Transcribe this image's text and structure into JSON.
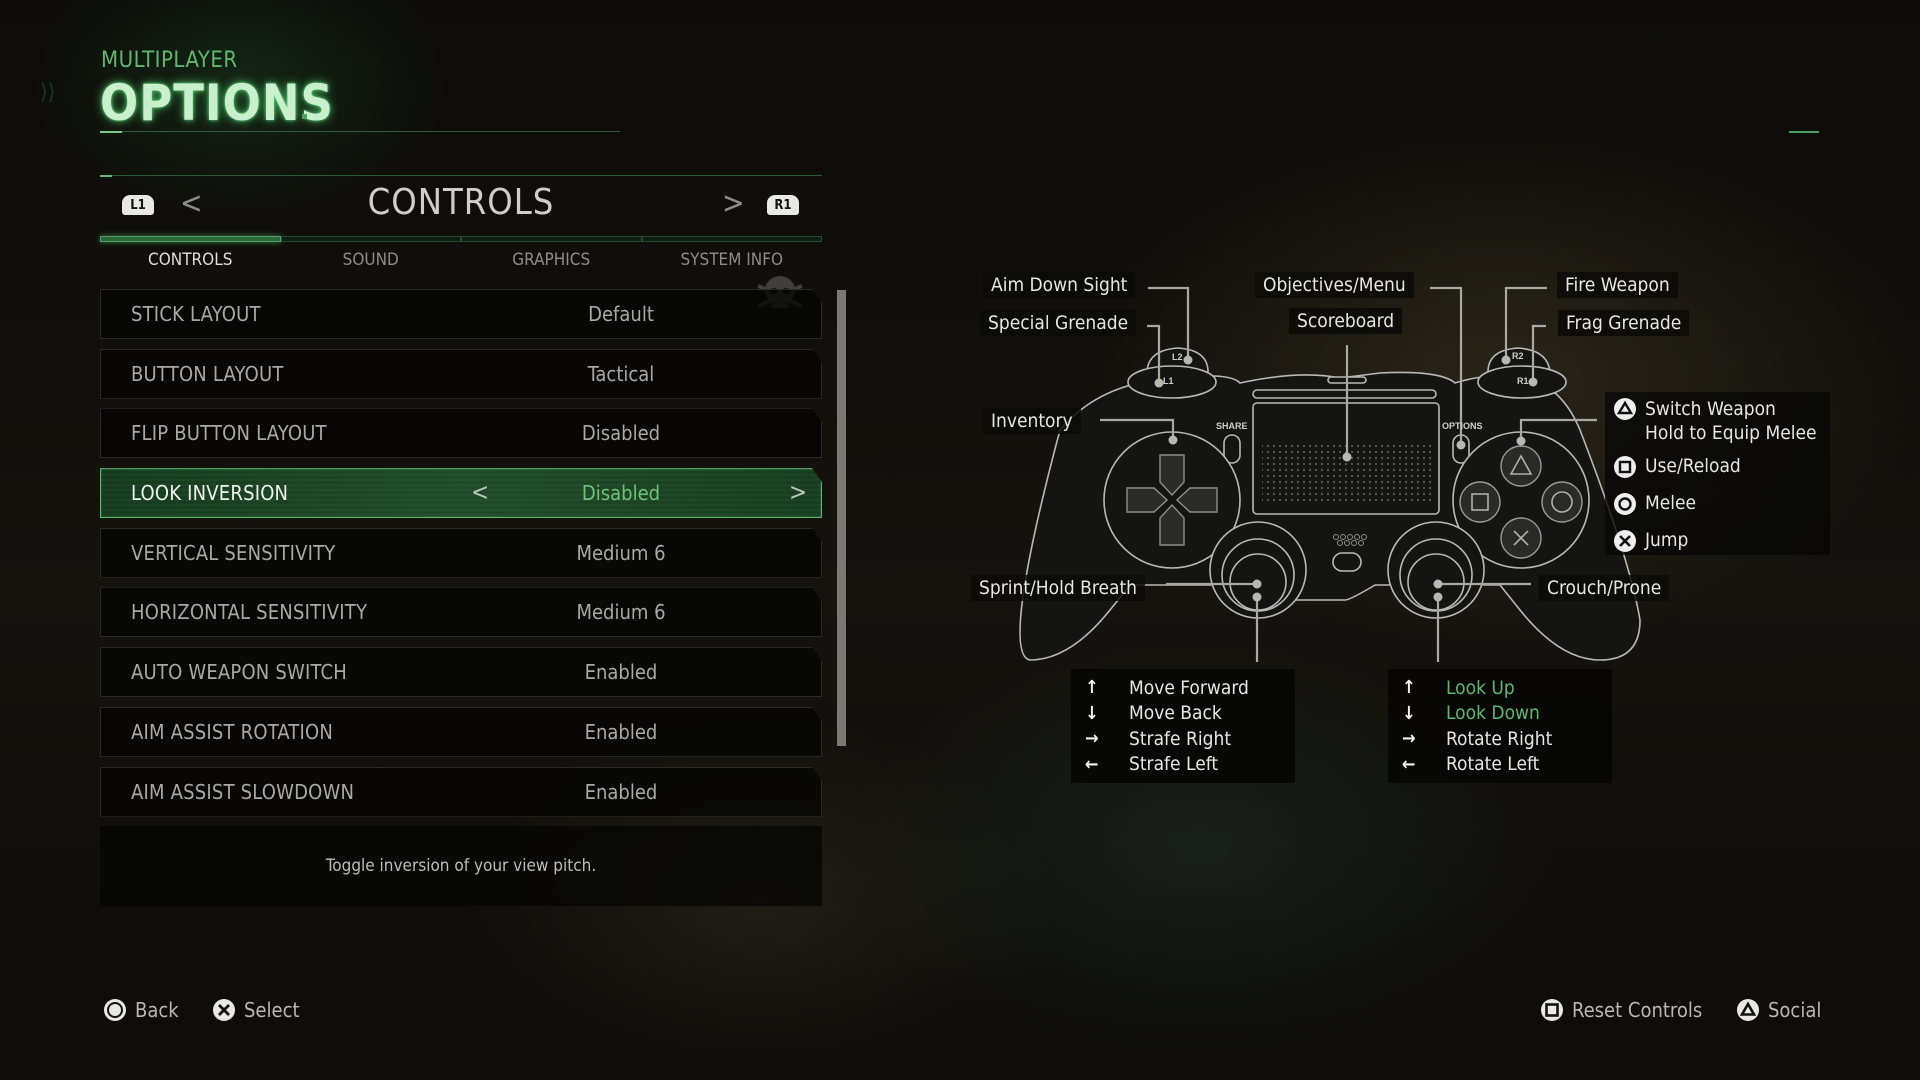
{
  "header": {
    "mode_label": "MULTIPLAYER",
    "title": "OPTIONS"
  },
  "section": {
    "left_bumper": "L1",
    "right_bumper": "R1",
    "title": "CONTROLS",
    "prev_arrow": "<",
    "next_arrow": ">"
  },
  "tabs": [
    {
      "label": "CONTROLS",
      "active": true
    },
    {
      "label": "SOUND",
      "active": false
    },
    {
      "label": "GRAPHICS",
      "active": false
    },
    {
      "label": "SYSTEM INFO",
      "active": false
    }
  ],
  "settings": [
    {
      "label": "STICK LAYOUT",
      "value": "Default"
    },
    {
      "label": "BUTTON LAYOUT",
      "value": "Tactical"
    },
    {
      "label": "FLIP BUTTON LAYOUT",
      "value": "Disabled"
    },
    {
      "label": "LOOK INVERSION",
      "value": "Disabled",
      "selected": true
    },
    {
      "label": "VERTICAL SENSITIVITY",
      "value": "Medium 6"
    },
    {
      "label": "HORIZONTAL SENSITIVITY",
      "value": "Medium 6"
    },
    {
      "label": "AUTO WEAPON SWITCH",
      "value": "Enabled"
    },
    {
      "label": "AIM ASSIST ROTATION",
      "value": "Enabled"
    },
    {
      "label": "AIM ASSIST SLOWDOWN",
      "value": "Enabled"
    }
  ],
  "selected_arrows": {
    "left": "<",
    "right": ">"
  },
  "description": "Toggle inversion of your view pitch.",
  "controller": {
    "button_labels": {
      "share": "SHARE",
      "options": "OPTIONS",
      "l1": "L1",
      "l2": "L2",
      "r1": "R1",
      "r2": "R2"
    },
    "callouts": {
      "l2": "Aim Down Sight",
      "l1": "Special Grenade",
      "options": "Objectives/Menu",
      "touchpad": "Scoreboard",
      "r2": "Fire Weapon",
      "r1": "Frag Grenade",
      "dpad": "Inventory",
      "l3": "Sprint/Hold Breath",
      "r3": "Crouch/Prone"
    },
    "face_buttons": [
      {
        "icon": "triangle-icon",
        "label": "Switch Weapon",
        "sublabel": "Hold to Equip Melee"
      },
      {
        "icon": "square-icon",
        "label": "Use/Reload"
      },
      {
        "icon": "circle-icon",
        "label": "Melee"
      },
      {
        "icon": "cross-icon",
        "label": "Jump"
      }
    ],
    "left_stick": [
      {
        "arrow": "↑",
        "label": "Move Forward"
      },
      {
        "arrow": "↓",
        "label": "Move Back"
      },
      {
        "arrow": "→",
        "label": "Strafe Right"
      },
      {
        "arrow": "←",
        "label": "Strafe Left"
      }
    ],
    "right_stick": [
      {
        "arrow": "↑",
        "label": "Look Up",
        "highlight": true
      },
      {
        "arrow": "↓",
        "label": "Look Down",
        "highlight": true
      },
      {
        "arrow": "→",
        "label": "Rotate Right"
      },
      {
        "arrow": "←",
        "label": "Rotate Left"
      }
    ]
  },
  "footer": {
    "back": "Back",
    "select": "Select",
    "reset": "Reset Controls",
    "social": "Social"
  },
  "colors": {
    "accent_green": "#5fb86f",
    "selected_value": "#6cc47a",
    "title_glow": "#c8f0cc"
  }
}
